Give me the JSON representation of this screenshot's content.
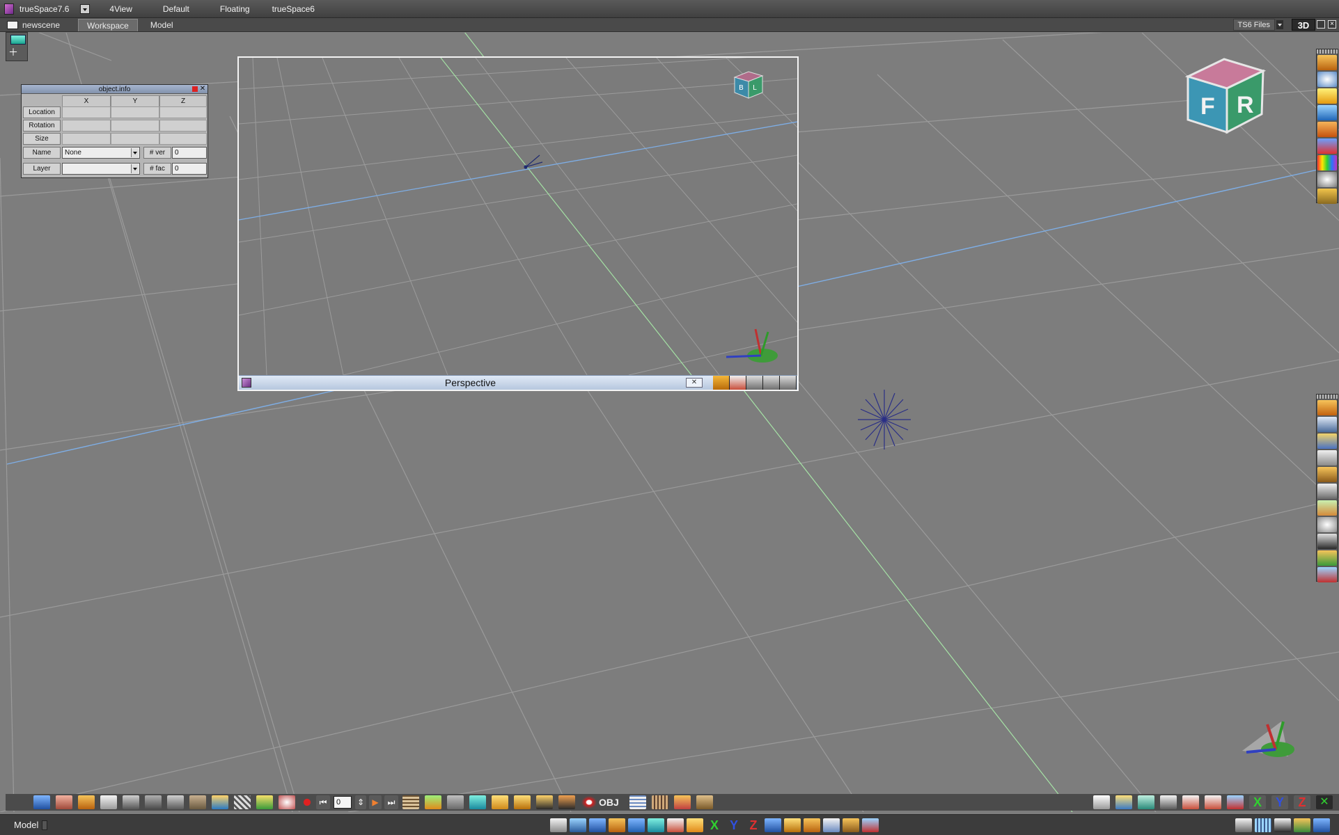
{
  "titlebar": {
    "app_title": "trueSpace7.6",
    "layouts": [
      "4View",
      "Default",
      "Floating",
      "trueSpace6"
    ]
  },
  "tabbar": {
    "scene": "newscene",
    "tabs": [
      "Workspace",
      "Model"
    ],
    "files_label": "TS6 Files",
    "mode_label": "3D"
  },
  "object_info": {
    "title": "object.info",
    "columns": [
      "X",
      "Y",
      "Z"
    ],
    "rows": [
      "Location",
      "Rotation",
      "Size"
    ],
    "name_label": "Name",
    "name_value": "None",
    "layer_label": "Layer",
    "layer_value": "",
    "ver_label": "# ver",
    "ver_value": "0",
    "fac_label": "# fac",
    "fac_value": "0"
  },
  "perspective_window": {
    "title": "Perspective",
    "close_glyph": "✕"
  },
  "nav_cube": {
    "main_faces": [
      "F",
      "R"
    ],
    "mini_faces": [
      "B",
      "L"
    ]
  },
  "bottom_toolbar": {
    "frame_value": "0",
    "obj_label": "OBJ"
  },
  "statusbar": {
    "mode": "Model"
  },
  "colors": {
    "viewport_bg": "#7d7d7d",
    "grid_line": "#9a9a9a",
    "axis_blue": "#79a9e0",
    "axis_green": "#9fdc9f",
    "panel_title_bg": "#93a3be",
    "perspective_bar_bg": "#c9d7ea"
  },
  "icons": {
    "right_toolbar_top": [
      "import-icon",
      "sphere-icon",
      "light-icon",
      "one-x-icon",
      "shape-icon",
      "no-material-icon",
      "color-gradient-icon",
      "globe-icon",
      "texture-icon"
    ],
    "right_toolbar_bottom": [
      "3d-paint-icon",
      "move-icon",
      "model-icon",
      "brush-icon",
      "lathe-icon",
      "axes-icon",
      "cube-edit-icon",
      "zoom-icon",
      "camera-icon",
      "figure-icon",
      "grid-axes-icon"
    ]
  }
}
